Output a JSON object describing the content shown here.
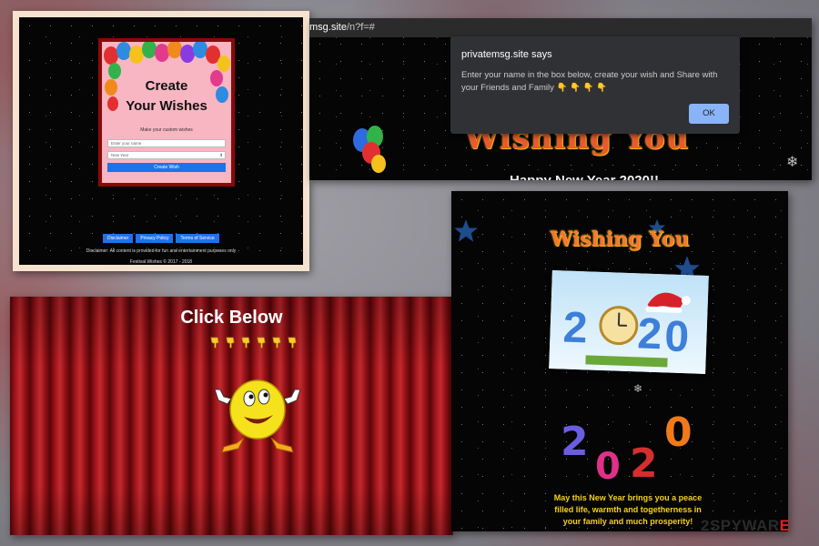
{
  "colors": {
    "accent_blue": "#1e73e8",
    "dark_red": "#8a0a0a",
    "card_pink": "#f8b5c2",
    "dialog_bg": "#303134",
    "ok_button": "#8ab4f8",
    "wishing_orange": "#f37830",
    "message_yellow": "#f6d01a"
  },
  "create_page": {
    "title": "Create\nYour Wishes",
    "subtitle": "Make your custom wishes",
    "name_placeholder": "Enter your name",
    "occasion_selected": "New Year",
    "create_button": "Create Wish",
    "footer_links": [
      "Disclaimer",
      "Privacy Policy",
      "Terms of Service"
    ],
    "disclaimer": "Disclaimer: All content is provided for fun and entertainment purposes only",
    "copyright": "Festival Wishes © 2017 - 2018"
  },
  "browser": {
    "url_host": "msg.site",
    "url_path": "/n?f=#",
    "background_heading": "Wishing You",
    "background_subheading": "Happy New Year 2020!!",
    "dialog": {
      "title": "privatemsg.site says",
      "message": "Enter your name in the box below, create your wish and Share with your Friends and Family 👇 👇 👇 👇",
      "ok_label": "OK"
    }
  },
  "click_page": {
    "heading": "Click Below",
    "pointing_hands_count": 6,
    "icon": "smiley-thumbs-up-icon"
  },
  "greeting_page": {
    "heading": "Wishing You",
    "year": "2020",
    "message": "May this New Year brings you a peace filled life, warmth and togetherness in your family and much prosperity!"
  },
  "watermark": {
    "prefix": "2",
    "name": "SPYWAR",
    "suffix": "E"
  }
}
